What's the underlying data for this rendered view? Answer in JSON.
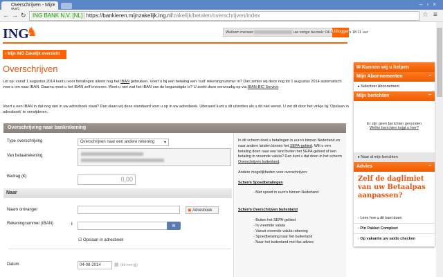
{
  "browser": {
    "tab_title": "Overschrijven - Mijn ING",
    "ev_label": "ING BANK N.V. [NL]",
    "url_scheme": "https://",
    "url_domain": "bankieren.mijnzakelijk.ing.nl",
    "url_path": "/zakelijk/betalen/overschrijven/index"
  },
  "header": {
    "logo": "ING",
    "welcome": "Welkom meneer",
    "last_visit": "uw vorige bezoek: 04-08-2014 om 18:11 uur",
    "logout": "Uitloggen"
  },
  "back_button": "‹ Mijn ING Zakelijk overzicht",
  "page_title": "Overschrijven",
  "intro": {
    "p1a": "Let op: vanaf 1 augustus 2014 kunt u voor betalingen alleen nog het ",
    "p1_link": "IBAN",
    "p1b": " gebruiken. Voert u bij een betaling een 'oud' rekeningnummer in? Dan zetten wij deze nog tot 1 augustus 2014 automatisch voor u om naar IBAN. Daarna moet u het IBAN zelf invoeren. Weet u niet wat het IBAN van de begunstigde is? U zoekt deze eenvoudig op via ",
    "p1_link2": "IBAN-BIC Service",
    "p2": "Voert u een IBAN in dat nog niet in uw adresboek staat? Dan slaan wij deze standaard voor u op in uw adresboek. Uiteraard kunt u dit uitzetten als u dit niet wenst. U zet dit door het vinkje bij 'Opslaan in adresboek' te verwijderen."
  },
  "form": {
    "section_title": "Overschrijving naar bankrekening",
    "type_label": "Type overschrijving",
    "type_value": "Overschrijven naar een andere rekening",
    "from_label": "Van betaalrekening",
    "amount_label": "Bedrag (€)",
    "amount_value": "0,00",
    "to_section": "Naar",
    "name_label": "Naam ontvanger",
    "name_value": "",
    "addressbook": "Adresboek",
    "iban_label": "Rekeningnummer (IBAN)",
    "info_icon": "i",
    "iban_value": "",
    "save_label": "Opslaan in adresboek",
    "save_checked": true,
    "date_label": "Datum",
    "date_value": "04-08-2014",
    "date_hint": "(dd-mm-jjjj)"
  },
  "info": {
    "t1": "In dit scherm doet u betalingen in euro's binnen Nederland en naar andere landen binnen het ",
    "sepa_link": "SEPA-gebied",
    "t2": ". Wilt u een betaling doen naar een land buiten het SEPA-gebied of een betaling in vreemde valuta? Dan kunt u dat doen in het scherm ",
    "buitenland_link": "Overschrijven buitenland",
    "t3": ".",
    "other": "Andere mogelijkheden voor overschrijven:",
    "spoed_title": "Scherm Spoedbetalingen",
    "spoed_items": [
      "- Met spoed in euro's binnen Nederland"
    ],
    "buiten_title": "Scherm Overschrijven buitenland",
    "buiten_items": [
      "- Buiten het SEPA-gebied",
      "- In vreemde valuta",
      "- Vanuit vreemde valuta rekening",
      "- Spoedbetaling naar het buitenland",
      "- Naar het buitenland met fax-advies"
    ]
  },
  "sidebar": {
    "help": "Kunnen wij u helpen",
    "subs_title": "Mijn Abonnementen",
    "subs_link": "Selecteer Abonnement",
    "msg_title": "Mijn berichten",
    "msg_none": "Er zijn geen berichten gevonden",
    "msg_link": "Welke berichten krijgt u hier?",
    "msg_all": "Naar al mijn berichten",
    "advies_title": "Advies",
    "advies_headline": "Zelf de daglimiet van uw Betaalpas aanpassen?",
    "advies_link": "Lees hoe u dit kunt doen",
    "links": [
      "Pin Pakket Compleet",
      "Op vakantie uw saldo checken"
    ],
    "collapse": "−"
  }
}
